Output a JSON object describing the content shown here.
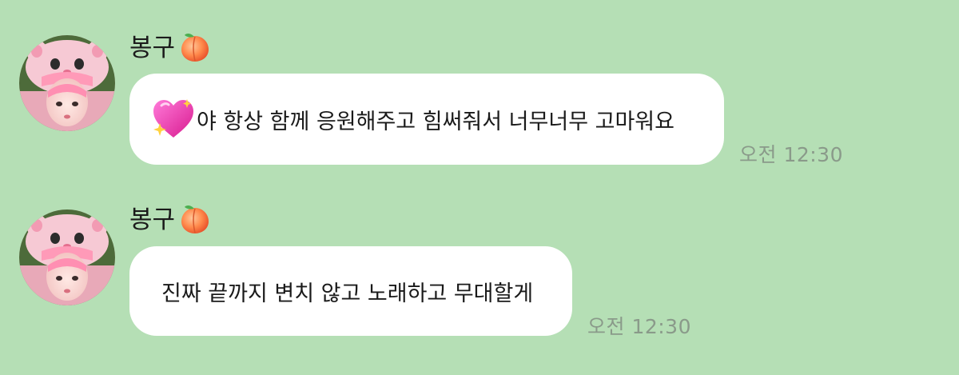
{
  "messages": [
    {
      "sender": "봉구",
      "sender_emoji": "peach-icon",
      "text": "야 항상 함께 응원해주고 힘써줘서 너무너무 고마워요",
      "leading_emoji": "sparkling-heart-icon",
      "time": "오전 12:30"
    },
    {
      "sender": "봉구",
      "sender_emoji": "peach-icon",
      "text": "진짜 끝까지 변치 않고 노래하고 무대할게",
      "time": "오전 12:30"
    }
  ],
  "colors": {
    "background": "#b5dfb5",
    "bubble": "#ffffff",
    "time_text": "#8a9a8a"
  }
}
